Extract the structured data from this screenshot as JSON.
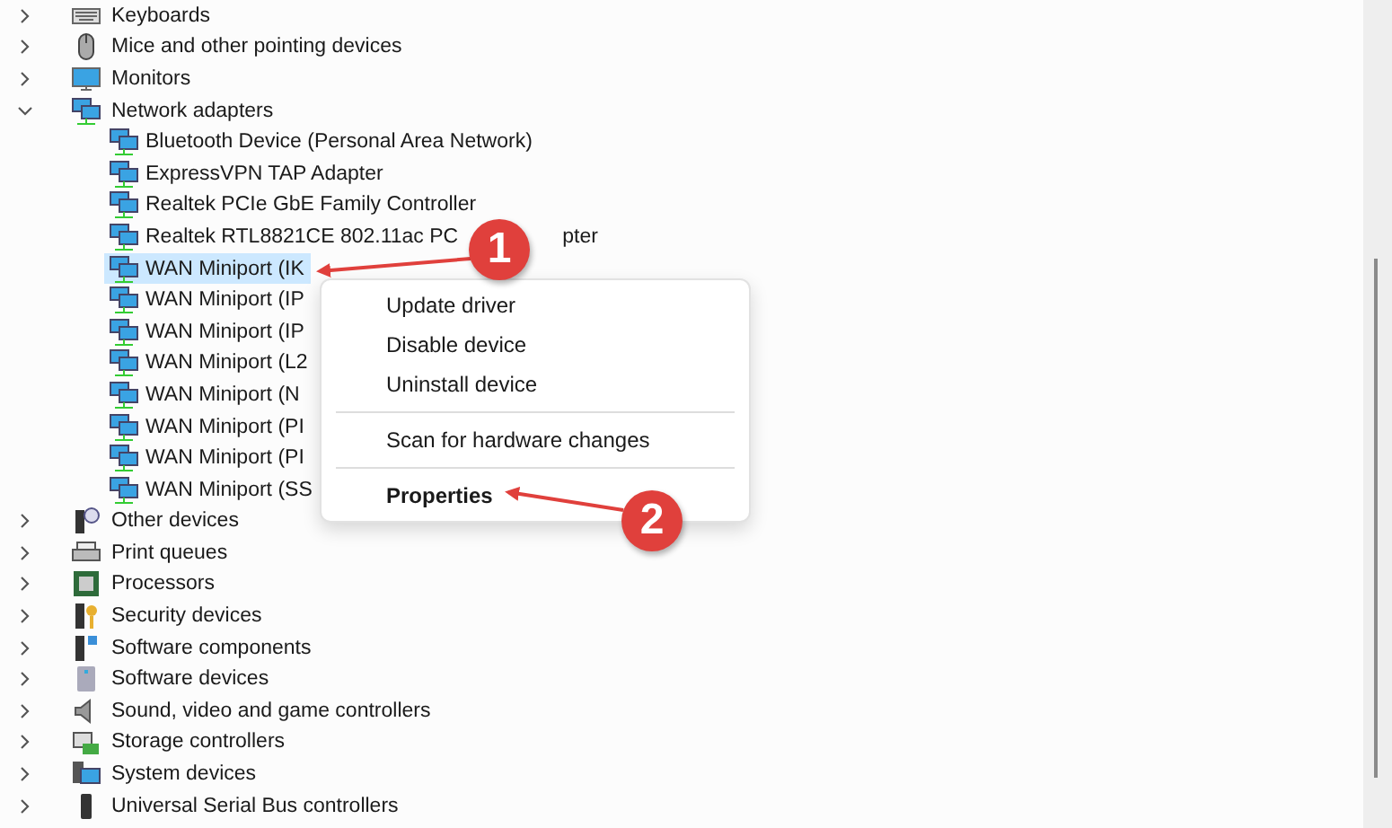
{
  "tree": [
    {
      "label": "Keyboards",
      "expanded": false,
      "selected": false
    },
    {
      "label": "Mice and other pointing devices",
      "expanded": false,
      "selected": false
    },
    {
      "label": "Monitors",
      "expanded": false,
      "selected": false
    },
    {
      "label": "Network adapters",
      "expanded": true,
      "selected": false,
      "children": [
        {
          "label": "Bluetooth Device (Personal Area Network)",
          "selected": false
        },
        {
          "label": "ExpressVPN TAP Adapter",
          "selected": false
        },
        {
          "label": "Realtek PCIe GbE Family Controller",
          "selected": false
        },
        {
          "label": "Realtek RTL8821CE 802.11ac PC",
          "tail": "pter",
          "selected": false
        },
        {
          "label": "WAN Miniport (IK",
          "selected": true
        },
        {
          "label": "WAN Miniport (IP",
          "selected": false
        },
        {
          "label": "WAN Miniport (IP",
          "selected": false
        },
        {
          "label": "WAN Miniport (L2",
          "selected": false
        },
        {
          "label": "WAN Miniport (N",
          "selected": false
        },
        {
          "label": "WAN Miniport (PI",
          "selected": false
        },
        {
          "label": "WAN Miniport (PI",
          "selected": false
        },
        {
          "label": "WAN Miniport (SS",
          "selected": false
        }
      ]
    },
    {
      "label": "Other devices",
      "expanded": false,
      "selected": false
    },
    {
      "label": "Print queues",
      "expanded": false,
      "selected": false
    },
    {
      "label": "Processors",
      "expanded": false,
      "selected": false
    },
    {
      "label": "Security devices",
      "expanded": false,
      "selected": false
    },
    {
      "label": "Software components",
      "expanded": false,
      "selected": false
    },
    {
      "label": "Software devices",
      "expanded": false,
      "selected": false
    },
    {
      "label": "Sound, video and game controllers",
      "expanded": false,
      "selected": false
    },
    {
      "label": "Storage controllers",
      "expanded": false,
      "selected": false
    },
    {
      "label": "System devices",
      "expanded": false,
      "selected": false
    },
    {
      "label": "Universal Serial Bus controllers",
      "expanded": false,
      "selected": false
    }
  ],
  "context_menu": [
    {
      "kind": "item",
      "label": "Update driver"
    },
    {
      "kind": "item",
      "label": "Disable device"
    },
    {
      "kind": "item",
      "label": "Uninstall device"
    },
    {
      "kind": "separator"
    },
    {
      "kind": "item",
      "label": "Scan for hardware changes"
    },
    {
      "kind": "separator"
    },
    {
      "kind": "default",
      "label": "Properties"
    }
  ],
  "callouts": [
    "1",
    "2"
  ]
}
